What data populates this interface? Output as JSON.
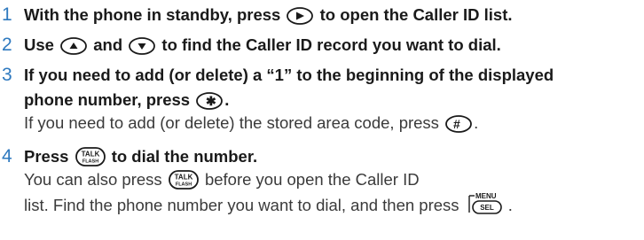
{
  "step1": {
    "number": "1",
    "text_a": "With the phone in standby, press",
    "text_b": "to open the Caller ID list."
  },
  "step2": {
    "number": "2",
    "text_a": "Use",
    "text_b": "and",
    "text_c": "to find the Caller ID record you want to dial."
  },
  "step3": {
    "number": "3",
    "line1": "If you need to add (or delete) a “1” to the beginning of the displayed",
    "line2": "phone number, press",
    "line2_end": ".",
    "line3": "If you need to add (or delete) the stored area code, press",
    "line3_end": "."
  },
  "step4": {
    "number": "4",
    "line1_a": "Press",
    "line1_b": "to dial the number.",
    "line2_a": "You can also press",
    "line2_b": "before you open the Caller ID",
    "line3_a": "list. Find the phone number you want to dial, and then press",
    "line3_end": "."
  },
  "keys": {
    "talk_top": "TALK",
    "talk_bottom": "FLASH",
    "star": "✱",
    "pound": "#",
    "sel": "SEL",
    "menu": "MENU"
  },
  "colors": {
    "step_number": "#2e79bf",
    "text": "#1a1a1a"
  }
}
